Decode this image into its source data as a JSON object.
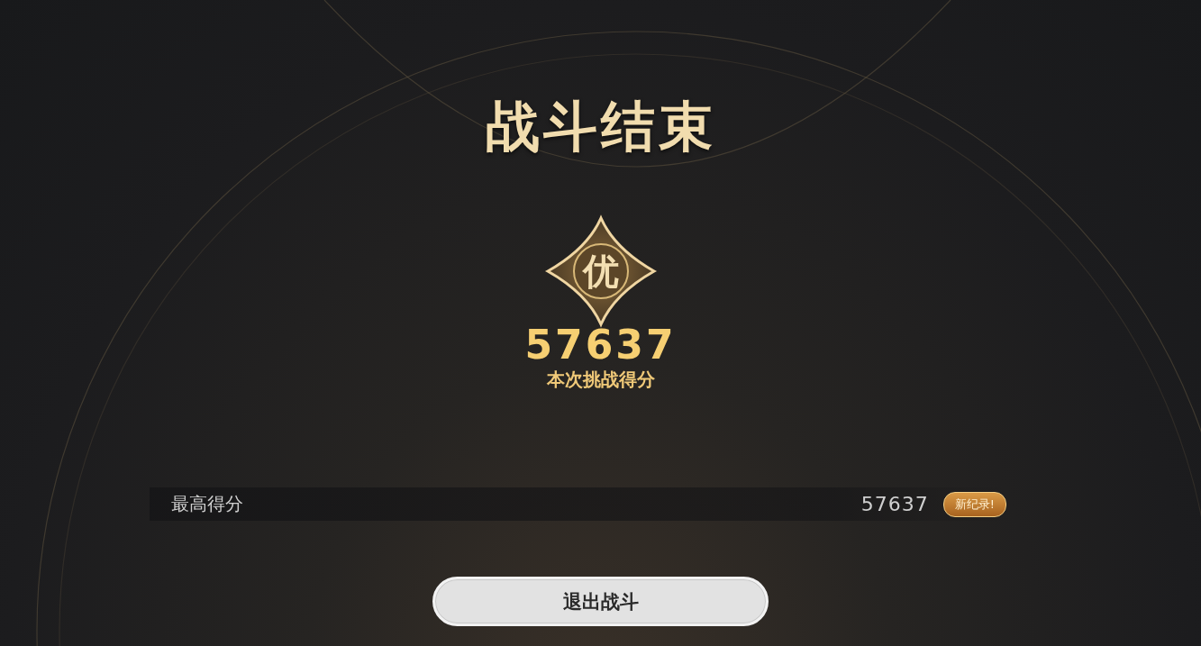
{
  "title": "战斗结束",
  "grade": "优",
  "score": {
    "value": "57637",
    "label": "本次挑战得分"
  },
  "best_score": {
    "label": "最高得分",
    "value": "57637",
    "badge": "新纪录!"
  },
  "buttons": [
    {
      "label": "退出战斗"
    }
  ]
}
